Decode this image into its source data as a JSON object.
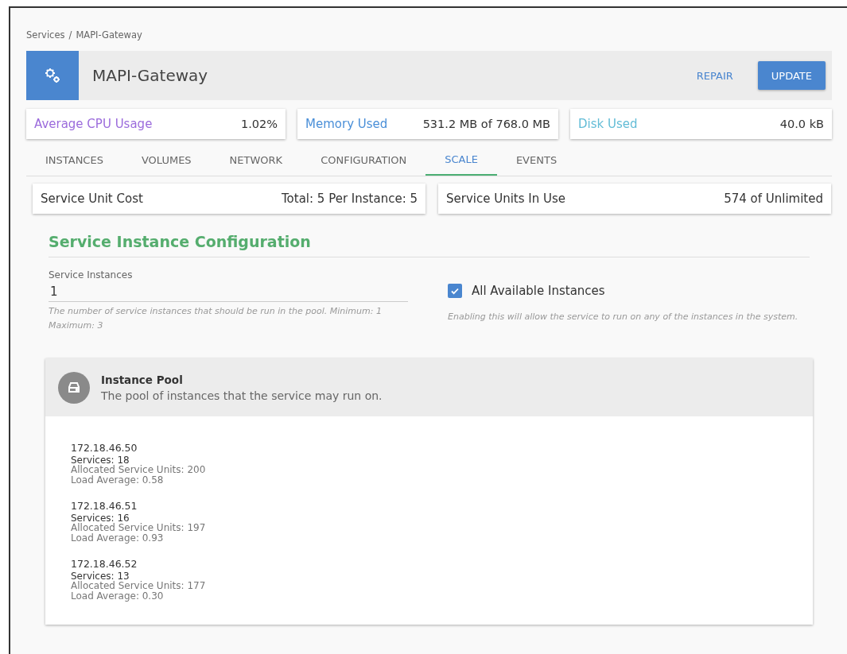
{
  "breadcrumb": {
    "items": [
      "Services",
      "MAPI-Gateway"
    ],
    "separator": "/"
  },
  "header": {
    "title": "MAPI-Gateway",
    "buttons": [
      {
        "label": "REPAIR",
        "kind": "flat"
      },
      {
        "label": "UPDATE",
        "kind": "raised"
      }
    ]
  },
  "stats": [
    {
      "label": "Average CPU Usage",
      "value": "1.02%",
      "color": "#9b6bdc"
    },
    {
      "label": "Memory Used",
      "value": "531.2 MB of 768.0 MB",
      "color": "#4a8fd8"
    },
    {
      "label": "Disk Used",
      "value": "40.0 kB",
      "color": "#62bcd6"
    }
  ],
  "tabs": [
    {
      "label": "INSTANCES",
      "selected": false
    },
    {
      "label": "VOLUMES",
      "selected": false
    },
    {
      "label": "NETWORK",
      "selected": false
    },
    {
      "label": "CONFIGURATION",
      "selected": false
    },
    {
      "label": "SCALE",
      "selected": true
    },
    {
      "label": "EVENTS",
      "selected": false
    }
  ],
  "units": [
    {
      "label": "Service Unit Cost",
      "value": "Total: 5 Per Instance: 5"
    },
    {
      "label": "Service Units In Use",
      "value": "574 of Unlimited"
    }
  ],
  "section_title": "Service Instance Configuration",
  "instances_field": {
    "label": "Service Instances",
    "value": "1",
    "help": "The number of service instances that should be run in the pool. Minimum: 1 Maximum: 3"
  },
  "all_instances": {
    "label": "All Available Instances",
    "checked": true,
    "help": "Enabling this will allow the service to run on any of the instances in the system."
  },
  "pool": {
    "title": "Instance Pool",
    "subtitle": "The pool of instances that the service may run on.",
    "instances": [
      {
        "address": "172.18.46.50",
        "services": "Services: 18",
        "allocated": "Allocated Service Units: 200",
        "load": "Load Average: 0.58"
      },
      {
        "address": "172.18.46.51",
        "services": "Services: 16",
        "allocated": "Allocated Service Units: 197",
        "load": "Load Average: 0.93"
      },
      {
        "address": "172.18.46.52",
        "services": "Services: 13",
        "allocated": "Allocated Service Units: 177",
        "load": "Load Average: 0.30"
      }
    ]
  }
}
